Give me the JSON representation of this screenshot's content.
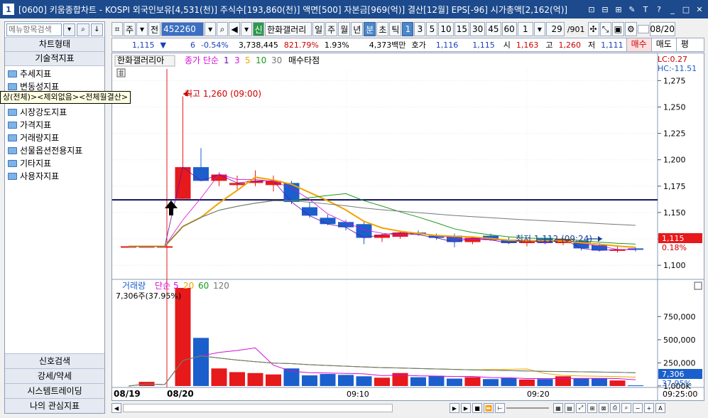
{
  "window": {
    "title": "[0600] 키움종합차트 - KOSPI 외국인보유[4,531(천)] 주식수[193,860(천)] 액면[500] 자본금[969(억)] 결산[12월] EPS[-96] 시가총액[2,162(억)]",
    "app_number": "1",
    "buttons": [
      "⊡",
      "⊟",
      "⊞",
      "✎",
      "T",
      "?",
      "_",
      "□",
      "✕"
    ]
  },
  "left_panel": {
    "search_placeholder": "메뉴항목검색",
    "chart_type_header": "차트형태",
    "tech_header": "기술적지표",
    "tree": [
      "추세지표",
      "변동성지표",
      "",
      "시장강도지표",
      "가격지표",
      "거래량지표",
      "선물옵션전용지표",
      "기타지표",
      "사용자지표"
    ],
    "bottom_buttons": [
      "신호검색",
      "강세/약세",
      "시스템트레이딩",
      "나의 관심지표"
    ],
    "tooltip": "상(전체)><제외없음><전체월결산>"
  },
  "toolbar": {
    "jong": "주",
    "jeon": "전",
    "code": "452260",
    "new_badge": "신",
    "stock_name": "한화갤러리",
    "periods": [
      "일",
      "주",
      "월",
      "년",
      "분",
      "초",
      "틱"
    ],
    "active_period": "분",
    "intervals": [
      "1",
      "3",
      "5",
      "10",
      "15",
      "30",
      "45",
      "60"
    ],
    "active_interval": "1",
    "count_value": "1",
    "page_value": "29",
    "page_total": "/901",
    "date_value": "08/20"
  },
  "quote": {
    "price": "1,115",
    "arrow": "▼",
    "change": "6",
    "change_pct": "-0.54%",
    "volume": "3,738,445",
    "vol_ratio": "821.79%",
    "turnover": "1.93%",
    "amount": "4,373백만",
    "ho_label": "호가",
    "ask": "1,116",
    "bid": "1,115",
    "open_label": "시",
    "open": "1,163",
    "high_label": "고",
    "high": "1,260",
    "low_label": "저",
    "low": "1,111",
    "buy": "매수",
    "sell": "매도",
    "eval": "평"
  },
  "chart": {
    "price_legend_name": "한화갤러리아",
    "ma_title": "종가 단순",
    "ma_periods": [
      "1",
      "3",
      "5",
      "10",
      "30"
    ],
    "extra_legend": "매수타점",
    "lc_label": "LC:0.27",
    "hc_label": "HC:-11.51",
    "high_annotation": "최고 1,260 (09:00)",
    "low_annotation": "최저 1,112 (09:24)",
    "price_axis_ticks": [
      "1,275",
      "1,250",
      "1,225",
      "1,200",
      "1,175",
      "1,150",
      "1,125",
      "1,100"
    ],
    "current_price_tag": "1,115",
    "current_pct_tag": "0.18%",
    "volume_legend_name": "거래량",
    "volume_ma_title": "단순",
    "volume_ma_periods": [
      "5",
      "20",
      "60",
      "120"
    ],
    "volume_info": "7,306주(37.95%)",
    "volume_axis_ticks": [
      "1,000K",
      "750,000",
      "500,000",
      "250,000"
    ],
    "current_volume_tag": "7,306",
    "current_volume_pct": "37.95%",
    "time_labels": [
      "08/19",
      "08/20",
      "09:10",
      "09:20",
      "09:25:00"
    ]
  },
  "chart_data": {
    "type": "candlestick",
    "price_unit": "KRW",
    "y_range": [
      1090,
      1282
    ],
    "candles": [
      {
        "o": 1118,
        "h": 1118,
        "l": 1118,
        "c": 1118
      },
      {
        "o": 1118,
        "h": 1118,
        "l": 1118,
        "c": 1118
      },
      {
        "o": 1118,
        "h": 1118,
        "l": 1118,
        "c": 1118
      },
      {
        "o": 1163,
        "h": 1260,
        "l": 1162,
        "c": 1193
      },
      {
        "o": 1193,
        "h": 1211,
        "l": 1180,
        "c": 1180
      },
      {
        "o": 1180,
        "h": 1188,
        "l": 1175,
        "c": 1186
      },
      {
        "o": 1176,
        "h": 1185,
        "l": 1172,
        "c": 1178
      },
      {
        "o": 1178,
        "h": 1190,
        "l": 1175,
        "c": 1180
      },
      {
        "o": 1176,
        "h": 1185,
        "l": 1170,
        "c": 1180
      },
      {
        "o": 1178,
        "h": 1180,
        "l": 1158,
        "c": 1160
      },
      {
        "o": 1155,
        "h": 1160,
        "l": 1145,
        "c": 1147
      },
      {
        "o": 1145,
        "h": 1148,
        "l": 1138,
        "c": 1139
      },
      {
        "o": 1141,
        "h": 1143,
        "l": 1133,
        "c": 1136
      },
      {
        "o": 1139,
        "h": 1141,
        "l": 1120,
        "c": 1126
      },
      {
        "o": 1126,
        "h": 1130,
        "l": 1122,
        "c": 1129
      },
      {
        "o": 1127,
        "h": 1132,
        "l": 1125,
        "c": 1131
      },
      {
        "o": 1131,
        "h": 1133,
        "l": 1128,
        "c": 1129
      },
      {
        "o": 1128,
        "h": 1130,
        "l": 1124,
        "c": 1126
      },
      {
        "o": 1128,
        "h": 1130,
        "l": 1117,
        "c": 1122
      },
      {
        "o": 1122,
        "h": 1127,
        "l": 1120,
        "c": 1126
      },
      {
        "o": 1128,
        "h": 1130,
        "l": 1123,
        "c": 1124
      },
      {
        "o": 1124,
        "h": 1127,
        "l": 1120,
        "c": 1121
      },
      {
        "o": 1121,
        "h": 1125,
        "l": 1118,
        "c": 1124
      },
      {
        "o": 1126,
        "h": 1128,
        "l": 1120,
        "c": 1121
      },
      {
        "o": 1121,
        "h": 1126,
        "l": 1119,
        "c": 1125
      },
      {
        "o": 1123,
        "h": 1124,
        "l": 1114,
        "c": 1116
      },
      {
        "o": 1119,
        "h": 1121,
        "l": 1113,
        "c": 1114
      },
      {
        "o": 1115,
        "h": 1118,
        "l": 1112,
        "c": 1115
      },
      {
        "o": 1116,
        "h": 1117,
        "l": 1113,
        "c": 1115
      }
    ],
    "volume_y_max": 1060000,
    "volume": [
      0,
      45000,
      0,
      1060000,
      520000,
      190000,
      150000,
      140000,
      125000,
      190000,
      115000,
      130000,
      120000,
      105000,
      90000,
      140000,
      95000,
      110000,
      80000,
      95000,
      75000,
      85000,
      70000,
      75000,
      105000,
      80000,
      85000,
      60000,
      7306
    ],
    "horizontal_line": 1162,
    "colors": {
      "up": "#e6191b",
      "down": "#1b5fcc",
      "ma3": "#d90bd9",
      "ma5": "#f0a400",
      "ma10": "#1a9a1a",
      "ma30": "#777777",
      "hline": "#101060"
    }
  }
}
